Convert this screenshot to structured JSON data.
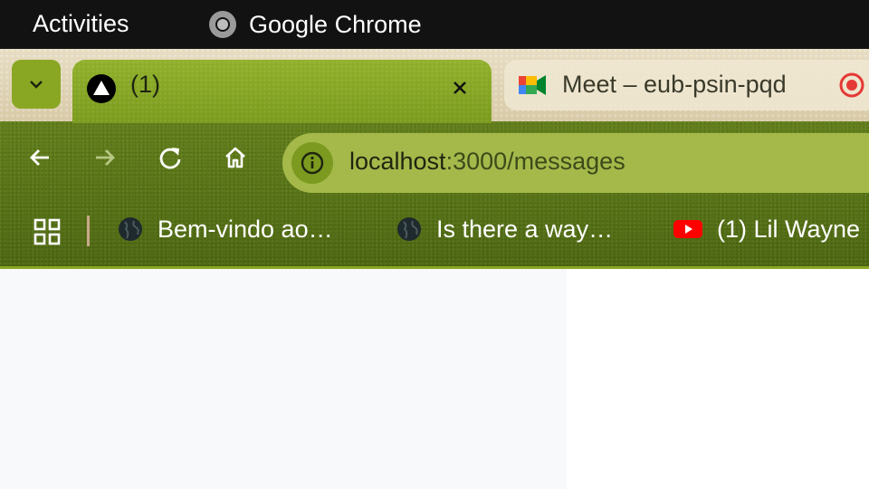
{
  "system_bar": {
    "activities": "Activities",
    "app_name": "Google Chrome",
    "app_icon": "chrome-icon"
  },
  "tabs": [
    {
      "title": "(1)",
      "icon": "nextjs-triangle-icon",
      "active": true
    },
    {
      "title": "Meet – eub-psin-pqd",
      "icon": "google-meet-icon",
      "active": false,
      "status_icon": "recording-icon"
    }
  ],
  "toolbar": {
    "url_host": "localhost",
    "url_path": ":3000/messages"
  },
  "bookmarks": [
    {
      "label": "Bem-vindo ao…",
      "icon": "globe-icon"
    },
    {
      "label": "Is there a way…",
      "icon": "globe-icon"
    },
    {
      "label": "(1) Lil Wayne",
      "icon": "youtube-icon"
    }
  ],
  "colors": {
    "theme_accent": "#8aa723",
    "omnibox": "#a4b94a",
    "topbar": "#121212"
  }
}
